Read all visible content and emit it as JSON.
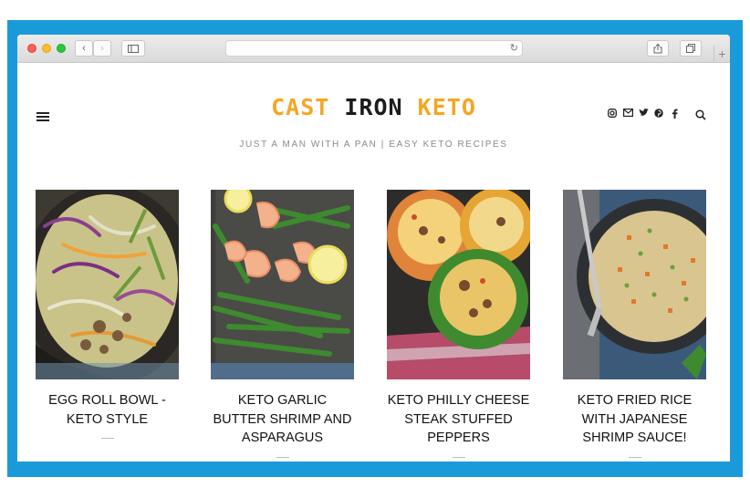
{
  "logo": {
    "part1": "CAST ",
    "part2": "IRON",
    "part3": " KETO"
  },
  "tagline": "JUST A MAN WITH A PAN | EASY KETO RECIPES",
  "social": [
    "instagram-icon",
    "email-icon",
    "twitter-icon",
    "pinterest-icon",
    "facebook-icon"
  ],
  "posts": [
    {
      "title": "EGG ROLL BOWL - KETO STYLE"
    },
    {
      "title": "KETO GARLIC BUTTER SHRIMP AND ASPARAGUS"
    },
    {
      "title": "KETO PHILLY CHEESE STEAK STUFFED PEPPERS"
    },
    {
      "title": "KETO FRIED RICE WITH JAPANESE SHRIMP SAUCE!"
    }
  ],
  "colors": {
    "frame": "#1b9ad9",
    "logo_accent": "#f5a623",
    "logo_dark": "#1c1c1c"
  }
}
